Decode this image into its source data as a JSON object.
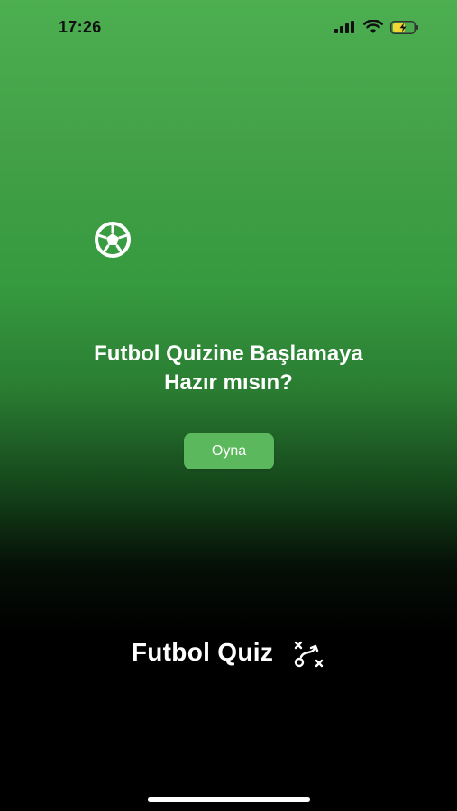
{
  "status_bar": {
    "time": "17:26"
  },
  "icons": {
    "ball": "soccer-ball-icon",
    "brand": "tactics-icon",
    "status": [
      "cellular-signal-icon",
      "wifi-icon",
      "battery-charging-icon"
    ]
  },
  "prompt": {
    "line1": "Futbol Quizine Başlamaya",
    "line2": "Hazır mısın?"
  },
  "play_button": {
    "label": "Oyna"
  },
  "brand": {
    "name": "Futbol Quiz"
  },
  "colors": {
    "gradient_top": "#4caf50",
    "gradient_bottom": "#000000",
    "button": "#5cb85c",
    "text": "#ffffff",
    "battery_fill": "#f2d733"
  }
}
